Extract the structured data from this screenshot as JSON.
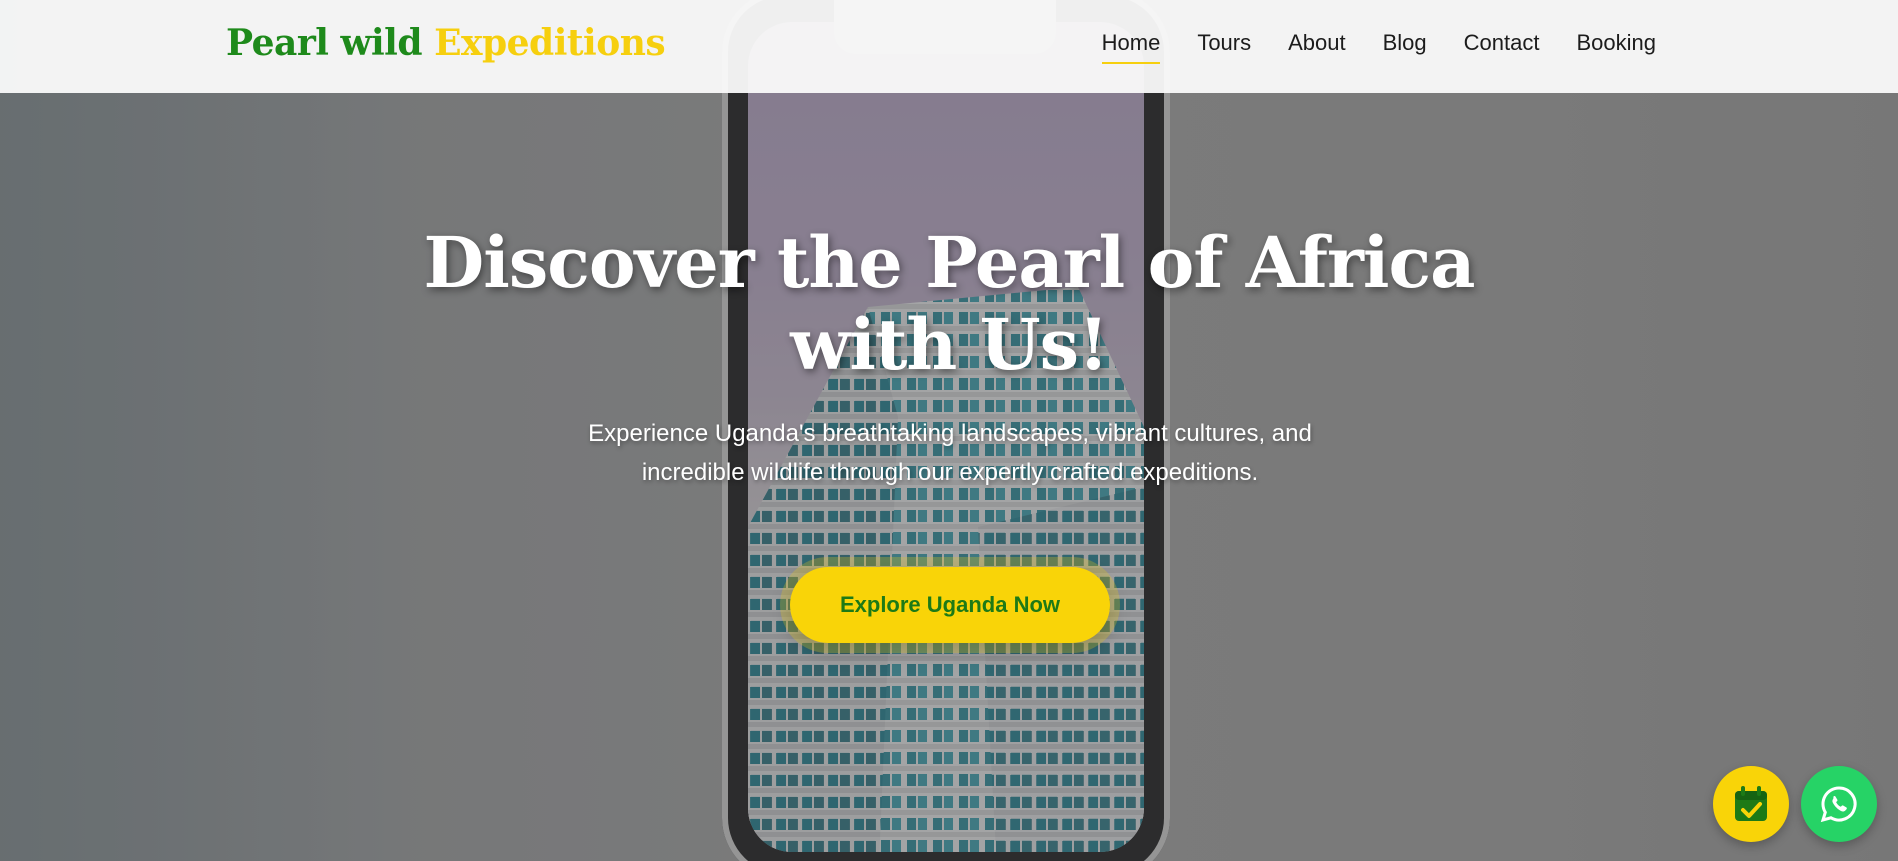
{
  "brand": {
    "part1": "Pearl wild",
    "part2": "Expeditions",
    "colors": {
      "green": "#1e8a1b",
      "yellow": "#f6cf0e"
    }
  },
  "nav": {
    "items": [
      {
        "label": "Home",
        "active": true
      },
      {
        "label": "Tours",
        "active": false
      },
      {
        "label": "About",
        "active": false
      },
      {
        "label": "Blog",
        "active": false
      },
      {
        "label": "Contact",
        "active": false
      },
      {
        "label": "Booking",
        "active": false
      }
    ]
  },
  "hero": {
    "title_line1": "Discover the Pearl of Africa",
    "title_line2": "with Us!",
    "subtitle": "Experience Uganda's breathtaking landscapes, vibrant cultures, and incredible wildlife through our expertly crafted expeditions.",
    "cta_label": "Explore Uganda Now"
  },
  "floating": {
    "booking_icon": "calendar-check-icon",
    "whatsapp_icon": "whatsapp-icon"
  }
}
